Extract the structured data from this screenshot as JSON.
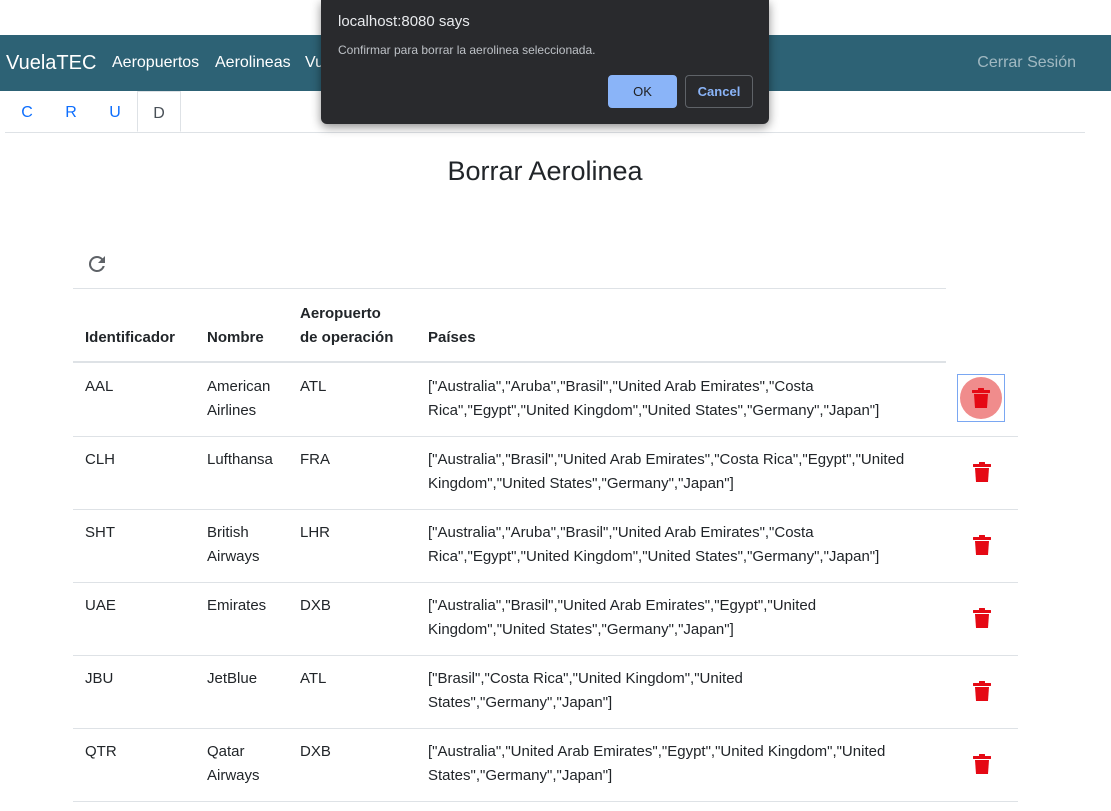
{
  "navbar": {
    "brand": "VuelaTEC",
    "links": [
      "Aeropuertos",
      "Aerolineas",
      "Vu"
    ],
    "logout": "Cerrar Sesión",
    "bg_color": "#2d6275"
  },
  "tabs": [
    "C",
    "R",
    "U",
    "D"
  ],
  "active_tab": "D",
  "page_title": "Borrar Aerolinea",
  "table": {
    "headers": {
      "id": "Identificador",
      "name": "Nombre",
      "airport_line1": "Aeropuerto",
      "airport_line2": "de operación",
      "countries": "Países"
    },
    "rows": [
      {
        "id": "AAL",
        "name1": "American",
        "name2": "Airlines",
        "airport": "ATL",
        "countries1": "[\"Australia\",\"Aruba\",\"Brasil\",\"United Arab Emirates\",\"Costa",
        "countries2": "Rica\",\"Egypt\",\"United Kingdom\",\"United States\",\"Germany\",\"Japan\"]"
      },
      {
        "id": "CLH",
        "name1": "Lufthansa",
        "name2": "",
        "airport": "FRA",
        "countries1": "[\"Australia\",\"Brasil\",\"United Arab Emirates\",\"Costa Rica\",\"Egypt\",\"United",
        "countries2": "Kingdom\",\"United States\",\"Germany\",\"Japan\"]"
      },
      {
        "id": "SHT",
        "name1": "British",
        "name2": "Airways",
        "airport": "LHR",
        "countries1": "[\"Australia\",\"Aruba\",\"Brasil\",\"United Arab Emirates\",\"Costa",
        "countries2": "Rica\",\"Egypt\",\"United Kingdom\",\"United States\",\"Germany\",\"Japan\"]"
      },
      {
        "id": "UAE",
        "name1": "Emirates",
        "name2": "",
        "airport": "DXB",
        "countries1": "[\"Australia\",\"Brasil\",\"United Arab Emirates\",\"Egypt\",\"United",
        "countries2": "Kingdom\",\"United States\",\"Germany\",\"Japan\"]"
      },
      {
        "id": "JBU",
        "name1": "JetBlue",
        "name2": "",
        "airport": "ATL",
        "countries1": "[\"Brasil\",\"Costa Rica\",\"United Kingdom\",\"United",
        "countries2": "States\",\"Germany\",\"Japan\"]"
      },
      {
        "id": "QTR",
        "name1": "Qatar",
        "name2": "Airways",
        "airport": "DXB",
        "countries1": "[\"Australia\",\"United Arab Emirates\",\"Egypt\",\"United Kingdom\",\"United",
        "countries2": "States\",\"Germany\",\"Japan\"]"
      }
    ]
  },
  "dialog": {
    "title": "localhost:8080 says",
    "message": "Confirmar para borrar la aerolinea seleccionada.",
    "ok_label": "OK",
    "cancel_label": "Cancel"
  },
  "icons": {
    "refresh": "refresh-icon",
    "delete": "trash-icon"
  },
  "colors": {
    "delete_red": "#e50914",
    "link_blue": "#0d6efd"
  }
}
